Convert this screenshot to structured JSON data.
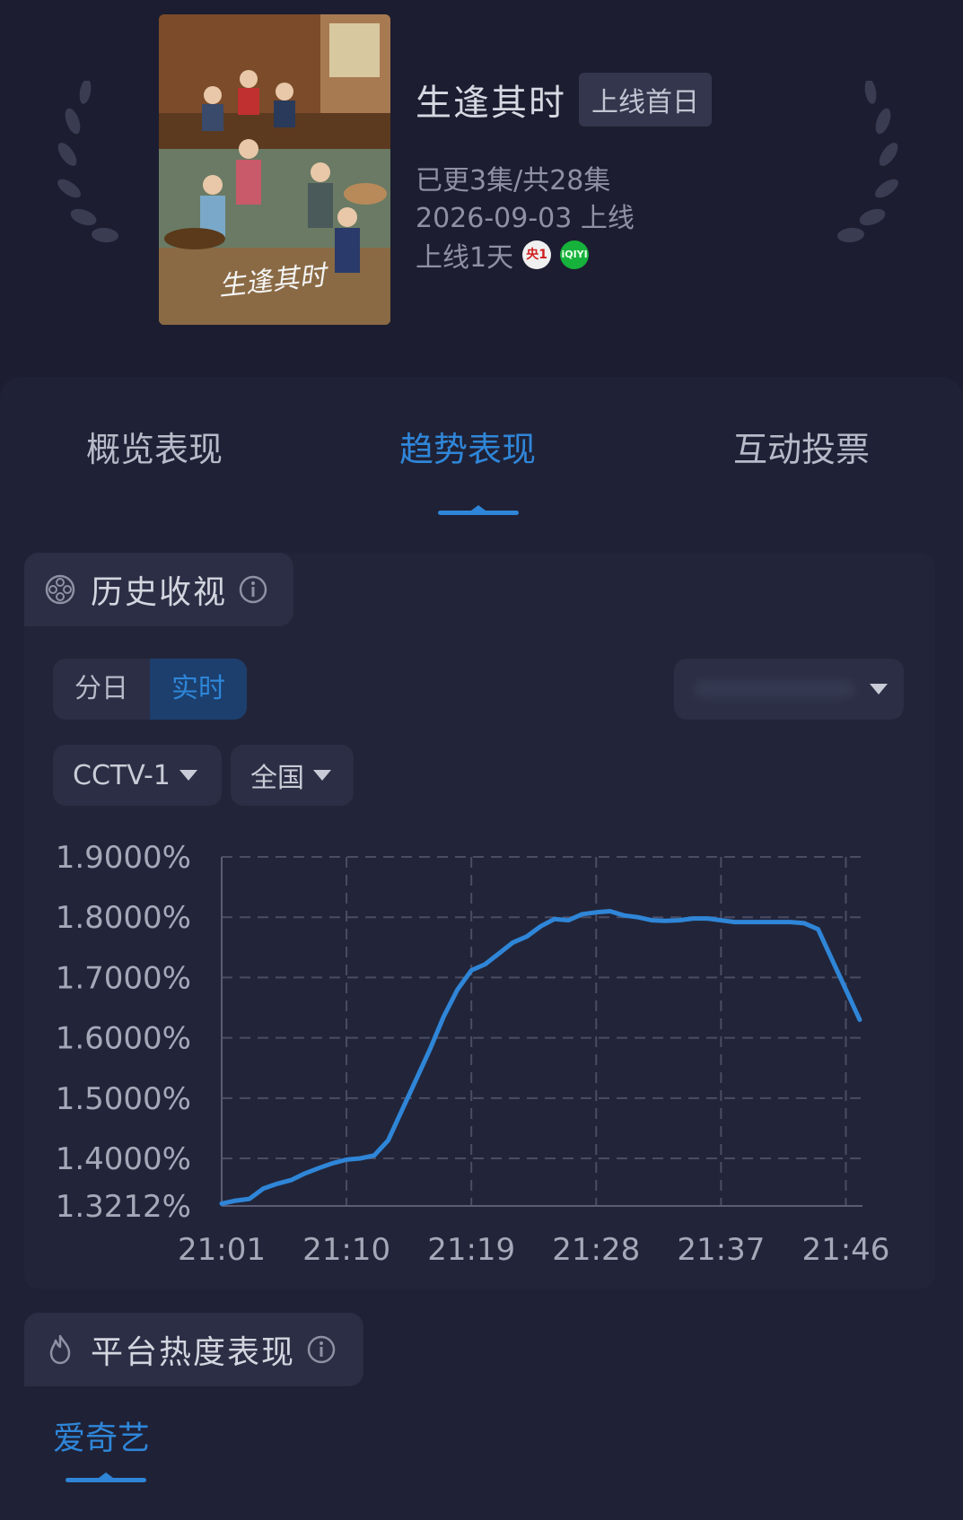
{
  "show": {
    "title": "生逢其时",
    "badge": "上线首日",
    "episodes": "已更3集/共28集",
    "launch_date": "2026-09-03 上线",
    "days_online": "上线1天",
    "channel_icons": [
      "cctv1-logo",
      "iqiyi-logo"
    ],
    "poster_text": "生逢其时"
  },
  "tabs": [
    {
      "label": "概览表现",
      "active": false
    },
    {
      "label": "趋势表现",
      "active": true
    },
    {
      "label": "互动投票",
      "active": false
    }
  ],
  "ratings_section": {
    "title": "历史收视",
    "toggle": [
      {
        "label": "分日",
        "active": false
      },
      {
        "label": "实时",
        "active": true
      }
    ],
    "channel_dropdown": "CCTV-1",
    "region_dropdown": "全国"
  },
  "heat_section": {
    "title": "平台热度表现",
    "platform_tab": "爱奇艺"
  },
  "colors": {
    "accent": "#2f86d8",
    "background": "#1c1d30",
    "panel": "#222539"
  },
  "chart_data": {
    "type": "line",
    "title": "",
    "xlabel": "",
    "ylabel": "",
    "x_ticks": [
      "21:01",
      "21:10",
      "21:19",
      "21:28",
      "21:37",
      "21:46"
    ],
    "y_ticks": [
      "1.3212%",
      "1.4000%",
      "1.5000%",
      "1.6000%",
      "1.7000%",
      "1.8000%",
      "1.9000%"
    ],
    "ylim": [
      1.3212,
      1.9
    ],
    "xlim_minutes": [
      1,
      46
    ],
    "grid": true,
    "series": [
      {
        "color": "#2f86d8",
        "x": [
          1,
          2,
          3,
          4,
          5,
          6,
          7,
          8,
          9,
          10,
          11,
          12,
          13,
          14,
          15,
          16,
          17,
          18,
          19,
          20,
          21,
          22,
          23,
          24,
          25,
          26,
          27,
          28,
          29,
          30,
          31,
          32,
          33,
          34,
          35,
          36,
          37,
          38,
          39,
          40,
          41,
          42,
          43,
          44,
          45,
          46,
          47
        ],
        "values": [
          1.325,
          1.33,
          1.333,
          1.35,
          1.358,
          1.364,
          1.375,
          1.384,
          1.392,
          1.398,
          1.4,
          1.405,
          1.43,
          1.48,
          1.53,
          1.58,
          1.635,
          1.68,
          1.712,
          1.722,
          1.74,
          1.758,
          1.768,
          1.785,
          1.797,
          1.795,
          1.805,
          1.808,
          1.81,
          1.803,
          1.8,
          1.795,
          1.794,
          1.795,
          1.798,
          1.798,
          1.795,
          1.792,
          1.792,
          1.792,
          1.792,
          1.792,
          1.79,
          1.78,
          1.73,
          1.68,
          1.63
        ]
      }
    ]
  }
}
